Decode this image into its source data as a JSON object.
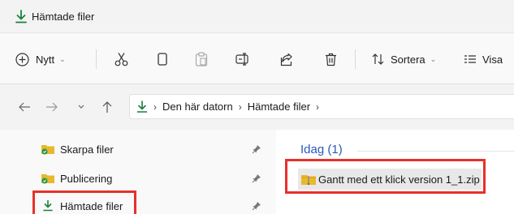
{
  "window": {
    "title": "Hämtade filer"
  },
  "toolbar": {
    "new_label": "Nytt",
    "sort_label": "Sortera",
    "view_label": "Visa"
  },
  "address": {
    "crumbs": [
      "Den här datorn",
      "Hämtade filer"
    ]
  },
  "sidebar": {
    "items": [
      {
        "label": "Skarpa filer"
      },
      {
        "label": "Publicering"
      },
      {
        "label": "Hämtade filer"
      }
    ]
  },
  "content": {
    "group_header": "Idag (1)",
    "files": [
      {
        "name": "Gantt med ett klick version 1_1.zip"
      }
    ]
  },
  "colors": {
    "highlight": "#e8302a",
    "download_green": "#1a7f3c",
    "folder_yellow": "#e9b82b",
    "group_header_blue": "#2a58b8"
  }
}
